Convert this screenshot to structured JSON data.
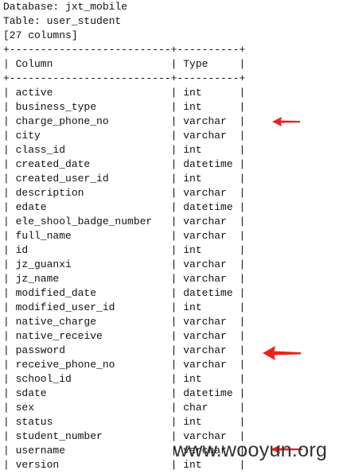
{
  "header": {
    "database_line": "Database: jxt_mobile",
    "table_line": "Table: user_student",
    "count_line": "[27 columns]"
  },
  "table": {
    "border": "+--------------------------+----------+",
    "header_row": "| Column                   | Type     |",
    "rows": [
      "| active                   | int      |",
      "| business_type            | int      |",
      "| charge_phone_no          | varchar  |",
      "| city                     | varchar  |",
      "| class_id                 | int      |",
      "| created_date             | datetime |",
      "| created_user_id          | int      |",
      "| description              | varchar  |",
      "| edate                    | datetime |",
      "| ele_shool_badge_number   | varchar  |",
      "| full_name                | varchar  |",
      "| id                       | int      |",
      "| jz_guanxi                | varchar  |",
      "| jz_name                  | varchar  |",
      "| modified_date            | datetime |",
      "| modified_user_id         | int      |",
      "| native_charge            | varchar  |",
      "| native_receive           | varchar  |",
      "| password                 | varchar  |",
      "| receive_phone_no         | varchar  |",
      "| school_id                | int      |",
      "| sdate                    | datetime |",
      "| sex                      | char     |",
      "| status                   | int      |",
      "| student_number           | varchar  |",
      "| username                 | varchar  |",
      "| version                  | int      |"
    ]
  },
  "annotations": {
    "arrow_color": "#e8231f",
    "highlight_color": "#dde0ee",
    "watermark": "www.wooyun.org"
  }
}
